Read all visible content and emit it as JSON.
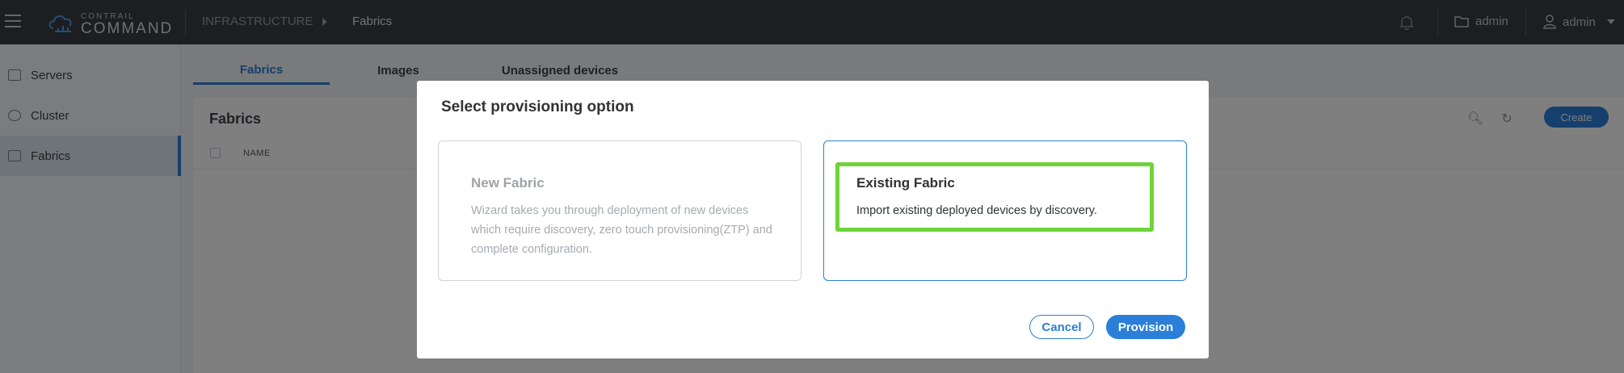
{
  "header": {
    "logo_small": "CONTRAIL",
    "logo_big": "COMMAND",
    "breadcrumb": [
      "INFRASTRUCTURE",
      "Fabrics"
    ],
    "project": "admin",
    "user": "admin"
  },
  "sidebar": {
    "items": [
      {
        "label": "Servers",
        "icon": "server-icon"
      },
      {
        "label": "Cluster",
        "icon": "cluster-icon"
      },
      {
        "label": "Fabrics",
        "icon": "fabric-icon",
        "active": true
      }
    ]
  },
  "main": {
    "tabs": [
      {
        "label": "Fabrics",
        "active": true
      },
      {
        "label": "Images"
      },
      {
        "label": "Unassigned devices"
      }
    ],
    "panel_title": "Fabrics",
    "create_label": "Create",
    "columns": [
      "NAME"
    ]
  },
  "modal": {
    "title": "Select provisioning option",
    "options": [
      {
        "title": "New Fabric",
        "description": "Wizard takes you through deployment of new devices which require discovery, zero touch provisioning(ZTP) and complete configuration.",
        "state": "disabled"
      },
      {
        "title": "Existing Fabric",
        "description": "Import existing deployed devices by discovery.",
        "state": "selected"
      }
    ],
    "cancel_label": "Cancel",
    "provision_label": "Provision"
  },
  "colors": {
    "accent": "#2b7fd8",
    "topbar": "#3a3d42",
    "highlight": "#6ed43a"
  }
}
